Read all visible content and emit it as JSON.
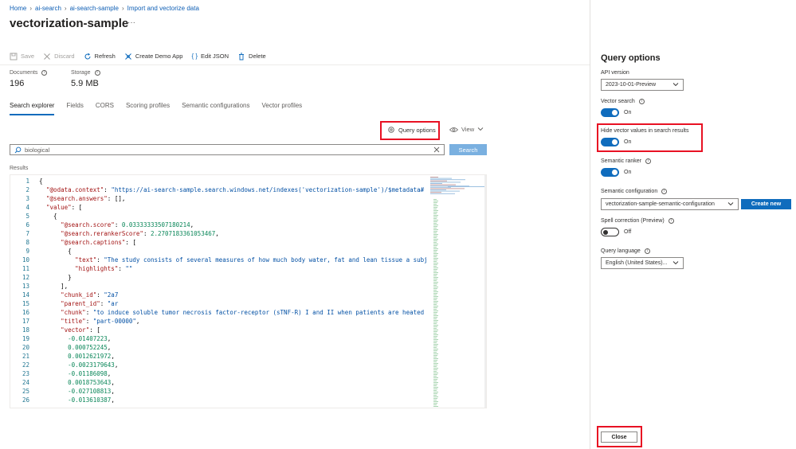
{
  "breadcrumb": [
    "Home",
    "ai-search",
    "ai-search-sample",
    "Import and vectorize data"
  ],
  "page_title": "vectorization-sample",
  "title_more": "···",
  "toolbar": {
    "save": "Save",
    "discard": "Discard",
    "refresh": "Refresh",
    "create_demo_app": "Create Demo App",
    "edit_json": "Edit JSON",
    "delete": "Delete"
  },
  "stats": {
    "documents_label": "Documents",
    "documents_value": "196",
    "storage_label": "Storage",
    "storage_value": "5.9 MB"
  },
  "tabs": [
    "Search explorer",
    "Fields",
    "CORS",
    "Scoring profiles",
    "Semantic configurations",
    "Vector profiles"
  ],
  "query_options_label": "Query options",
  "view_label": "View",
  "search": {
    "value": "biological",
    "button": "Search"
  },
  "results_label": "Results",
  "code_lines": [
    {
      "n": "1",
      "t": [
        [
          "p",
          "{"
        ]
      ]
    },
    {
      "n": "2",
      "t": [
        [
          "p",
          "  "
        ],
        [
          "k",
          "\"@odata.context\""
        ],
        [
          "p",
          ": "
        ],
        [
          "s",
          "\"https://ai-search-sample.search.windows.net/indexes('vectorization-sample')/$metadata#"
        ]
      ]
    },
    {
      "n": "3",
      "t": [
        [
          "p",
          "  "
        ],
        [
          "k",
          "\"@search.answers\""
        ],
        [
          "p",
          ": [],"
        ]
      ]
    },
    {
      "n": "4",
      "t": [
        [
          "p",
          "  "
        ],
        [
          "k",
          "\"value\""
        ],
        [
          "p",
          ": ["
        ]
      ]
    },
    {
      "n": "5",
      "t": [
        [
          "p",
          "    {"
        ]
      ]
    },
    {
      "n": "6",
      "t": [
        [
          "p",
          "      "
        ],
        [
          "k",
          "\"@search.score\""
        ],
        [
          "p",
          ": "
        ],
        [
          "n",
          "0.03333333507180214"
        ],
        [
          "p",
          ","
        ]
      ]
    },
    {
      "n": "7",
      "t": [
        [
          "p",
          "      "
        ],
        [
          "k",
          "\"@search.rerankerScore\""
        ],
        [
          "p",
          ": "
        ],
        [
          "n",
          "2.2707183361053467"
        ],
        [
          "p",
          ","
        ]
      ]
    },
    {
      "n": "8",
      "t": [
        [
          "p",
          "      "
        ],
        [
          "k",
          "\"@search.captions\""
        ],
        [
          "p",
          ": ["
        ]
      ]
    },
    {
      "n": "9",
      "t": [
        [
          "p",
          "        {"
        ]
      ]
    },
    {
      "n": "10",
      "t": [
        [
          "p",
          "          "
        ],
        [
          "k",
          "\"text\""
        ],
        [
          "p",
          ": "
        ],
        [
          "s",
          "\"The study consists of several measures of how much body water, fat and lean tissue a subj"
        ]
      ]
    },
    {
      "n": "11",
      "t": [
        [
          "p",
          "          "
        ],
        [
          "k",
          "\"highlights\""
        ],
        [
          "p",
          ": "
        ],
        [
          "s",
          "\"\""
        ]
      ]
    },
    {
      "n": "12",
      "t": [
        [
          "p",
          "        }"
        ]
      ]
    },
    {
      "n": "13",
      "t": [
        [
          "p",
          "      ],"
        ]
      ]
    },
    {
      "n": "14",
      "t": [
        [
          "p",
          "      "
        ],
        [
          "k",
          "\"chunk_id\""
        ],
        [
          "p",
          ": "
        ],
        [
          "s",
          "\"2a7"
        ]
      ]
    },
    {
      "n": "15",
      "t": [
        [
          "p",
          "      "
        ],
        [
          "k",
          "\"parent_id\""
        ],
        [
          "p",
          ": "
        ],
        [
          "s",
          "\"ar"
        ]
      ]
    },
    {
      "n": "16",
      "t": [
        [
          "p",
          "      "
        ],
        [
          "k",
          "\"chunk\""
        ],
        [
          "p",
          ": "
        ],
        [
          "s",
          "\"to induce soluble tumor necrosis factor-receptor (sTNF-R) I and II when patients are heated"
        ]
      ]
    },
    {
      "n": "17",
      "t": [
        [
          "p",
          "      "
        ],
        [
          "k",
          "\"title\""
        ],
        [
          "p",
          ": "
        ],
        [
          "s",
          "\"part-00000\""
        ],
        [
          "p",
          ","
        ]
      ]
    },
    {
      "n": "18",
      "t": [
        [
          "p",
          "      "
        ],
        [
          "k",
          "\"vector\""
        ],
        [
          "p",
          ": ["
        ]
      ]
    },
    {
      "n": "19",
      "t": [
        [
          "p",
          "        "
        ],
        [
          "n",
          "-0.01407223"
        ],
        [
          "p",
          ","
        ]
      ]
    },
    {
      "n": "20",
      "t": [
        [
          "p",
          "        "
        ],
        [
          "n",
          "0.000752245"
        ],
        [
          "p",
          ","
        ]
      ]
    },
    {
      "n": "21",
      "t": [
        [
          "p",
          "        "
        ],
        [
          "n",
          "0.0012621972"
        ],
        [
          "p",
          ","
        ]
      ]
    },
    {
      "n": "22",
      "t": [
        [
          "p",
          "        "
        ],
        [
          "n",
          "-0.0023179643"
        ],
        [
          "p",
          ","
        ]
      ]
    },
    {
      "n": "23",
      "t": [
        [
          "p",
          "        "
        ],
        [
          "n",
          "-0.01186098"
        ],
        [
          "p",
          ","
        ]
      ]
    },
    {
      "n": "24",
      "t": [
        [
          "p",
          "        "
        ],
        [
          "n",
          "0.0018753643"
        ],
        [
          "p",
          ","
        ]
      ]
    },
    {
      "n": "25",
      "t": [
        [
          "p",
          "        "
        ],
        [
          "n",
          "-0.027108813"
        ],
        [
          "p",
          ","
        ]
      ]
    },
    {
      "n": "26",
      "t": [
        [
          "p",
          "        "
        ],
        [
          "n",
          "-0.013610387"
        ],
        [
          "p",
          ","
        ]
      ]
    }
  ],
  "panel": {
    "title": "Query options",
    "api_version_label": "API version",
    "api_version_value": "2023-10-01-Preview",
    "vector_search_label": "Vector search",
    "vector_search_state": "On",
    "hide_vector_label": "Hide vector values in search results",
    "hide_vector_state": "On",
    "semantic_ranker_label": "Semantic ranker",
    "semantic_ranker_state": "On",
    "semantic_config_label": "Semantic configuration",
    "semantic_config_value": "vectorization-sample-semantic-configuration",
    "create_new": "Create new",
    "spell_label": "Spell correction (Preview)",
    "spell_state": "Off",
    "query_language_label": "Query language",
    "query_language_value": "English (United States)...",
    "close": "Close"
  },
  "colors": {
    "accent": "#0f6cbd",
    "highlight_box": "#e81123",
    "link": "#0f5fb5"
  }
}
